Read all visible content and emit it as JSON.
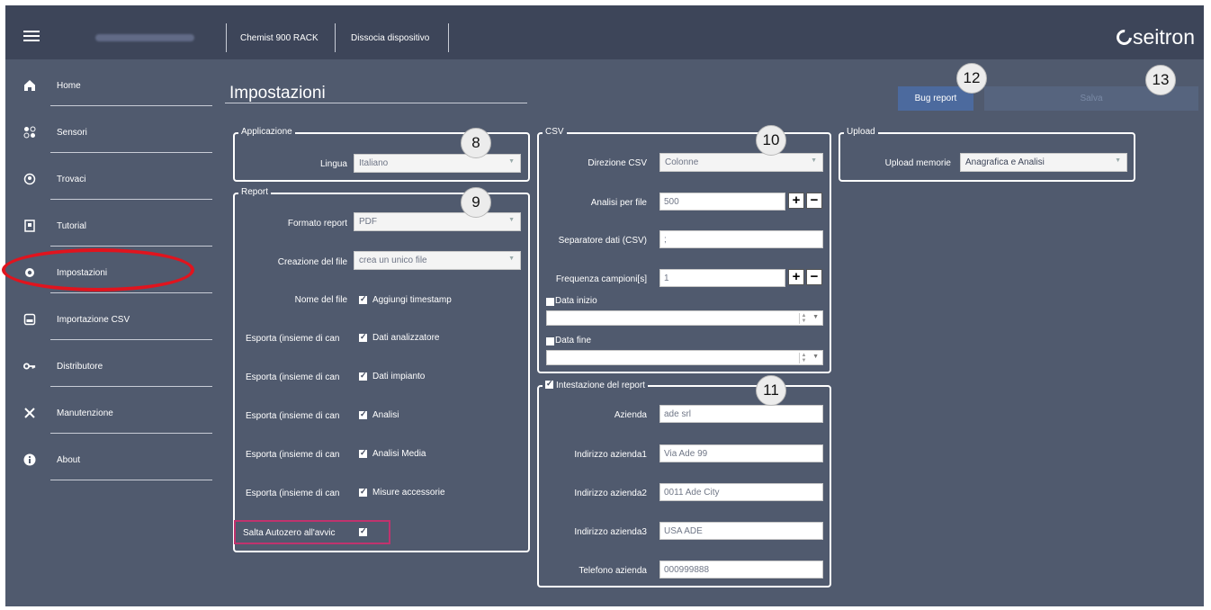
{
  "topbar": {
    "device": "Chemist 900 RACK",
    "dissocia": "Dissocia dispositivo",
    "logo": "seitron"
  },
  "sidebar": {
    "items": [
      {
        "label": "Home",
        "icon": "home-icon"
      },
      {
        "label": "Sensori",
        "icon": "sensors-icon"
      },
      {
        "label": "Trovaci",
        "icon": "location-pin-icon"
      },
      {
        "label": "Tutorial",
        "icon": "tutorial-book-icon"
      },
      {
        "label": "Impostazioni",
        "icon": "gear-icon"
      },
      {
        "label": "Importazione CSV",
        "icon": "csv-file-icon"
      },
      {
        "label": "Distributore",
        "icon": "key-icon"
      },
      {
        "label": "Manutenzione",
        "icon": "tools-icon"
      },
      {
        "label": "About",
        "icon": "info-icon"
      }
    ]
  },
  "main": {
    "title": "Impostazioni",
    "bug_report": "Bug report",
    "save": "Salva"
  },
  "badges": {
    "b8": "8",
    "b9": "9",
    "b10": "10",
    "b11": "11",
    "b12": "12",
    "b13": "13"
  },
  "applicazione": {
    "legend": "Applicazione",
    "lingua_label": "Lingua",
    "lingua_value": "Italiano"
  },
  "report": {
    "legend": "Report",
    "formato_label": "Formato report",
    "formato_value": "PDF",
    "creazione_label": "Creazione del file",
    "creazione_value": "crea un unico file",
    "nome_label": "Nome del file",
    "nome_cb": "Aggiungi timestamp",
    "esporta_label1": "Esporta (insieme di can",
    "esporta_cb1": "Dati analizzatore",
    "esporta_label2": "Esporta (insieme di can",
    "esporta_cb2": "Dati impianto",
    "esporta_label3": "Esporta (insieme di can",
    "esporta_cb3": "Analisi",
    "esporta_label4": "Esporta (insieme di can",
    "esporta_cb4": "Analisi Media",
    "esporta_label5": "Esporta (insieme di can",
    "esporta_cb5": "Misure accessorie",
    "salta_label": "Salta Autozero all'avvic"
  },
  "csv": {
    "legend": "CSV",
    "direzione_label": "Direzione CSV",
    "direzione_value": "Colonne",
    "analisi_label": "Analisi per file",
    "analisi_value": "500",
    "separatore_label": "Separatore dati (CSV)",
    "separatore_value": ";",
    "frequenza_label": "Frequenza campioni[s]",
    "frequenza_value": "1",
    "data_inizio": "Data inizio",
    "data_fine": "Data fine"
  },
  "intestazione": {
    "legend": "Intestazione del report",
    "azienda_label": "Azienda",
    "azienda_value": "ade srl",
    "ind1_label": "Indirizzo azienda1",
    "ind1_value": "Via Ade 99",
    "ind2_label": "Indirizzo azienda2",
    "ind2_value": "0011 Ade City",
    "ind3_label": "Indirizzo azienda3",
    "ind3_value": "USA ADE",
    "tel_label": "Telefono azienda",
    "tel_value": "000999888"
  },
  "upload": {
    "legend": "Upload",
    "upload_label": "Upload memorie",
    "upload_value": "Anagrafica e Analisi"
  },
  "colors": {
    "background": "#505a6e",
    "topbar": "#3d4559",
    "accent_button": "#4c6a9e",
    "highlight_red": "#e0141e",
    "highlight_pink": "#c0336e"
  }
}
